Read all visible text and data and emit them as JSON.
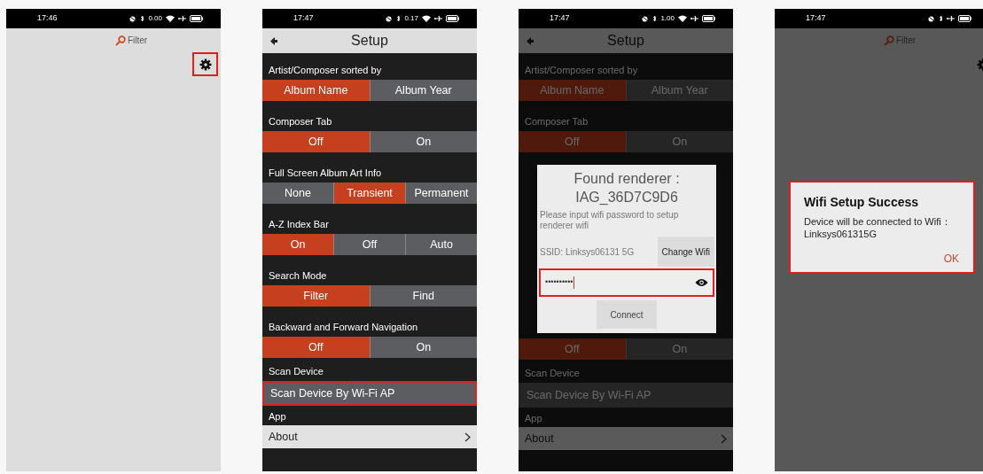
{
  "screens": [
    {
      "kind": "home",
      "status_bar": {
        "time": "17:46",
        "speed": "0.00",
        "wifi": true
      },
      "dimmed": false,
      "filter": "Filter",
      "settings_highlighted": true
    },
    {
      "kind": "setup",
      "status_bar": {
        "time": "17:47",
        "speed": "0.17",
        "wifi": true
      },
      "dimmed": false,
      "title": "Setup",
      "sections": [
        {
          "kind": "options",
          "label": "Artist/Composer sorted by",
          "options": [
            {
              "label": "Album Name",
              "selected": true
            },
            {
              "label": "Album Year",
              "selected": false
            }
          ]
        },
        {
          "kind": "options",
          "label": "Composer Tab",
          "options": [
            {
              "label": "Off",
              "selected": true
            },
            {
              "label": "On",
              "selected": false
            }
          ]
        },
        {
          "kind": "options",
          "label": "Full Screen Album Art Info",
          "options": [
            {
              "label": "None",
              "selected": false
            },
            {
              "label": "Transient",
              "selected": true
            },
            {
              "label": "Permanent",
              "selected": false
            }
          ]
        },
        {
          "kind": "options",
          "label": "A-Z Index Bar",
          "options": [
            {
              "label": "On",
              "selected": true
            },
            {
              "label": "Off",
              "selected": false
            },
            {
              "label": "Auto",
              "selected": false
            }
          ]
        },
        {
          "kind": "options",
          "label": "Search Mode",
          "options": [
            {
              "label": "Filter",
              "selected": true
            },
            {
              "label": "Find",
              "selected": false
            }
          ]
        },
        {
          "kind": "options",
          "label": "Backward and Forward Navigation",
          "options": [
            {
              "label": "Off",
              "selected": true
            },
            {
              "label": "On",
              "selected": false
            }
          ]
        }
      ],
      "scan": {
        "label": "Scan Device",
        "item": "Scan Device By Wi-Fi AP",
        "highlighted": true
      },
      "app": {
        "label": "App",
        "item": "About"
      }
    },
    {
      "kind": "setup",
      "status_bar": {
        "time": "17:47",
        "speed": "1.00",
        "wifi": true
      },
      "dimmed": true,
      "title": "Setup",
      "sections": [
        {
          "kind": "options",
          "label": "Artist/Composer sorted by",
          "options": [
            {
              "label": "Album Name",
              "selected": true
            },
            {
              "label": "Album Year",
              "selected": false
            }
          ]
        },
        {
          "kind": "options",
          "label": "Composer Tab",
          "options": [
            {
              "label": "Off",
              "selected": true
            },
            {
              "label": "On",
              "selected": false
            }
          ]
        },
        {
          "kind": "covered"
        },
        {
          "kind": "options",
          "options": [
            {
              "label": "Off",
              "selected": true
            },
            {
              "label": "On",
              "selected": false
            }
          ]
        }
      ],
      "scan": {
        "label": "Scan Device",
        "item": "Scan Device By Wi-Fi AP",
        "highlighted": false
      },
      "app": {
        "label": "App",
        "item": "About"
      },
      "dialog": {
        "kind": "wifi_password",
        "title": "Found renderer :",
        "renderer": "IAG_36D7C9D6",
        "message": "Please input wifi password to setup renderer wifi",
        "ssid": "SSID: Linksys06131 5G",
        "change_button": "Change Wifi",
        "password": "••••••••••",
        "field_highlighted": true,
        "connect_button": "Connect"
      }
    },
    {
      "kind": "home",
      "status_bar": {
        "time": "17:47",
        "wifi": false
      },
      "dimmed": true,
      "filter": "Filter",
      "settings_highlighted": false,
      "dialog": {
        "kind": "message",
        "title": "Wifi Setup Success",
        "message": "Device will be connected to Wifi：Linksys061315G",
        "button": "OK",
        "highlighted": true
      }
    }
  ]
}
